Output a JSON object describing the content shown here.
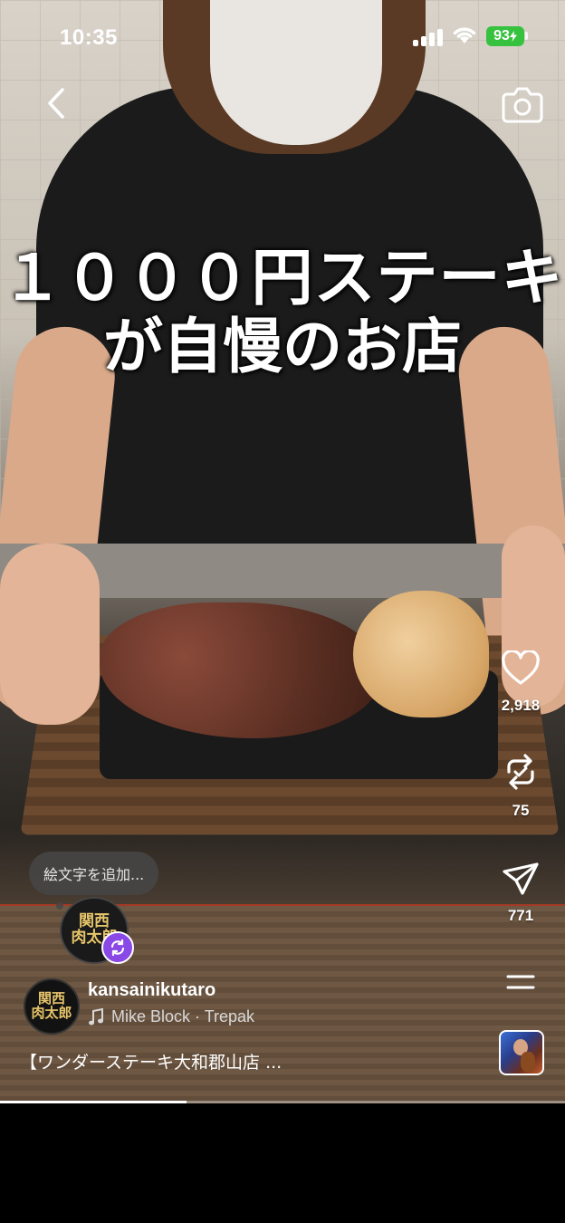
{
  "status_bar": {
    "time": "10:35",
    "battery": "93"
  },
  "video": {
    "caption_line1": "１０００円ステーキ",
    "caption_line2": "が自慢のお店",
    "progress": 0.33
  },
  "actions": {
    "likes": "2,918",
    "reposts": "75",
    "shares": "771"
  },
  "emoji_prompt": "絵文字を追加...",
  "story_avatar_text": "関西 肉太郎",
  "profile": {
    "username": "kansainikutaro",
    "avatar_text": "関西 肉太郎"
  },
  "music": {
    "track": "Mike Block · Trepak"
  },
  "description": "【ワンダーステーキ大和郡山店 ...",
  "icons": [
    "back-icon",
    "camera-icon",
    "heart-icon",
    "repost-icon",
    "send-icon",
    "menu-icon",
    "music-note-icon",
    "remix-icon"
  ]
}
